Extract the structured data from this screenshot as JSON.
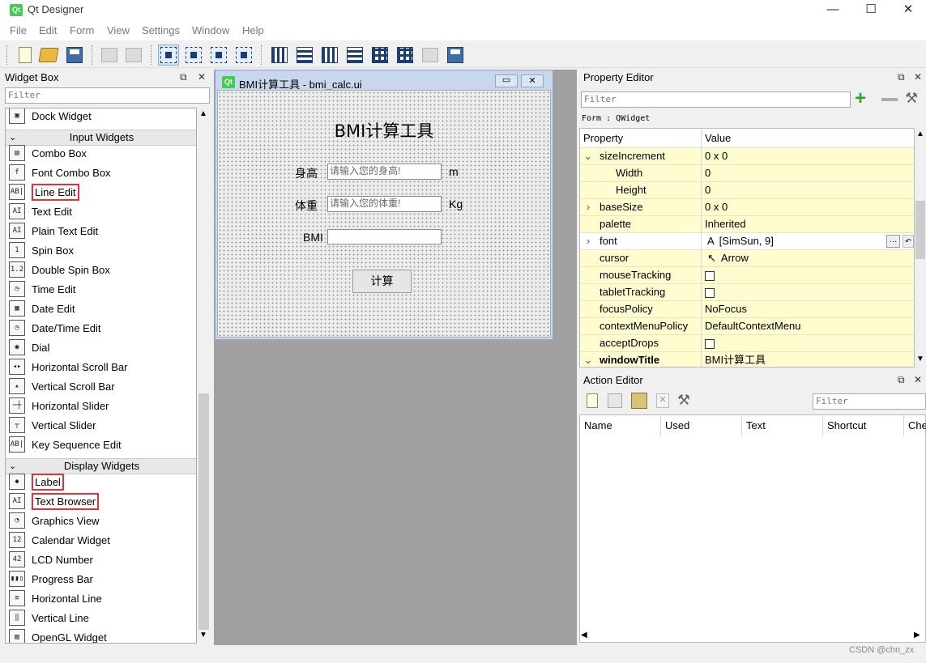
{
  "window": {
    "title": "Qt Designer",
    "logo_text": "Qt",
    "controls": [
      "—",
      "☐",
      "✕"
    ]
  },
  "menu": [
    "File",
    "Edit",
    "Form",
    "View",
    "Settings",
    "Window",
    "Help"
  ],
  "widget_box": {
    "title": "Widget Box",
    "filter_placeholder": "Filter",
    "items": [
      {
        "kind": "item",
        "label": "Dock Widget",
        "icon": "dock-widget-icon",
        "glyph": "▣"
      },
      {
        "kind": "category",
        "label": "Input Widgets"
      },
      {
        "kind": "item",
        "label": "Combo Box",
        "icon": "combo-box-icon",
        "glyph": "▤"
      },
      {
        "kind": "item",
        "label": "Font Combo Box",
        "icon": "font-combo-box-icon",
        "glyph": "f"
      },
      {
        "kind": "item",
        "label": "Line Edit",
        "icon": "line-edit-icon",
        "glyph": "AB|",
        "highlight": true
      },
      {
        "kind": "item",
        "label": "Text Edit",
        "icon": "text-edit-icon",
        "glyph": "AI"
      },
      {
        "kind": "item",
        "label": "Plain Text Edit",
        "icon": "plain-text-edit-icon",
        "glyph": "AI"
      },
      {
        "kind": "item",
        "label": "Spin Box",
        "icon": "spin-box-icon",
        "glyph": "1"
      },
      {
        "kind": "item",
        "label": "Double Spin Box",
        "icon": "double-spin-box-icon",
        "glyph": "1.2"
      },
      {
        "kind": "item",
        "label": "Time Edit",
        "icon": "time-edit-icon",
        "glyph": "◷"
      },
      {
        "kind": "item",
        "label": "Date Edit",
        "icon": "date-edit-icon",
        "glyph": "▦"
      },
      {
        "kind": "item",
        "label": "Date/Time Edit",
        "icon": "date-time-edit-icon",
        "glyph": "◷"
      },
      {
        "kind": "item",
        "label": "Dial",
        "icon": "dial-icon",
        "glyph": "◉"
      },
      {
        "kind": "item",
        "label": "Horizontal Scroll Bar",
        "icon": "horizontal-scroll-bar-icon",
        "glyph": "◂▸"
      },
      {
        "kind": "item",
        "label": "Vertical Scroll Bar",
        "icon": "vertical-scroll-bar-icon",
        "glyph": "▴"
      },
      {
        "kind": "item",
        "label": "Horizontal Slider",
        "icon": "horizontal-slider-icon",
        "glyph": "─┼"
      },
      {
        "kind": "item",
        "label": "Vertical Slider",
        "icon": "vertical-slider-icon",
        "glyph": "┬"
      },
      {
        "kind": "item",
        "label": "Key Sequence Edit",
        "icon": "key-sequence-edit-icon",
        "glyph": "AB|"
      },
      {
        "kind": "category",
        "label": "Display Widgets"
      },
      {
        "kind": "item",
        "label": "Label",
        "icon": "label-icon",
        "glyph": "◆",
        "highlight": true
      },
      {
        "kind": "item",
        "label": "Text Browser",
        "icon": "text-browser-icon",
        "glyph": "AI",
        "highlight": true
      },
      {
        "kind": "item",
        "label": "Graphics View",
        "icon": "graphics-view-icon",
        "glyph": "◔"
      },
      {
        "kind": "item",
        "label": "Calendar Widget",
        "icon": "calendar-widget-icon",
        "glyph": "12"
      },
      {
        "kind": "item",
        "label": "LCD Number",
        "icon": "lcd-number-icon",
        "glyph": "42"
      },
      {
        "kind": "item",
        "label": "Progress Bar",
        "icon": "progress-bar-icon",
        "glyph": "▮▮▯"
      },
      {
        "kind": "item",
        "label": "Horizontal Line",
        "icon": "horizontal-line-icon",
        "glyph": "≡"
      },
      {
        "kind": "item",
        "label": "Vertical Line",
        "icon": "vertical-line-icon",
        "glyph": "‖"
      },
      {
        "kind": "item",
        "label": "OpenGL Widget",
        "icon": "opengl-widget-icon",
        "glyph": "▨"
      }
    ]
  },
  "form": {
    "window_title": "BMI计算工具 - bmi_calc.ui",
    "heading": "BMI计算工具",
    "height_label": "身高",
    "height_placeholder": "请输入您的身高!",
    "height_unit": "m",
    "weight_label": "体重",
    "weight_placeholder": "请输入您的体重!",
    "weight_unit": "Kg",
    "bmi_label": "BMI",
    "bmi_value": "",
    "calc_button": "计算"
  },
  "property_editor": {
    "title": "Property Editor",
    "filter_placeholder": "Filter",
    "object_line": "Form : QWidget",
    "header_property": "Property",
    "header_value": "Value",
    "rows": [
      {
        "name": "sizeIncrement",
        "value": "0 x 0",
        "indent": 0,
        "expander": "⌄",
        "bg": "yellow"
      },
      {
        "name": "Width",
        "value": "0",
        "indent": 1,
        "expander": "",
        "bg": "yellow"
      },
      {
        "name": "Height",
        "value": "0",
        "indent": 1,
        "expander": "",
        "bg": "yellow"
      },
      {
        "name": "baseSize",
        "value": "0 x 0",
        "indent": 0,
        "expander": "›",
        "bg": "yellow"
      },
      {
        "name": "palette",
        "value": "Inherited",
        "indent": 0,
        "expander": "",
        "bg": "yellow"
      },
      {
        "name": "font",
        "value": "[SimSun, 9]",
        "indent": 0,
        "expander": "›",
        "bg": "white",
        "prefix": "A"
      },
      {
        "name": "cursor",
        "value": "Arrow",
        "indent": 0,
        "expander": "",
        "bg": "yellow",
        "prefix": "↖"
      },
      {
        "name": "mouseTracking",
        "value": "",
        "indent": 0,
        "expander": "",
        "bg": "yellow",
        "checkbox": true
      },
      {
        "name": "tabletTracking",
        "value": "",
        "indent": 0,
        "expander": "",
        "bg": "yellow",
        "checkbox": true
      },
      {
        "name": "focusPolicy",
        "value": "NoFocus",
        "indent": 0,
        "expander": "",
        "bg": "yellow"
      },
      {
        "name": "contextMenuPolicy",
        "value": "DefaultContextMenu",
        "indent": 0,
        "expander": "",
        "bg": "yellow"
      },
      {
        "name": "acceptDrops",
        "value": "",
        "indent": 0,
        "expander": "",
        "bg": "yellow",
        "checkbox": true
      },
      {
        "name": "windowTitle",
        "value": "BMI计算工具",
        "indent": 0,
        "expander": "⌄",
        "bg": "yellow",
        "bold": true
      }
    ]
  },
  "action_editor": {
    "title": "Action Editor",
    "filter_placeholder": "Filter",
    "columns": [
      "Name",
      "Used",
      "Text",
      "Shortcut",
      "Che"
    ]
  },
  "watermark": "CSDN @chn_zx"
}
